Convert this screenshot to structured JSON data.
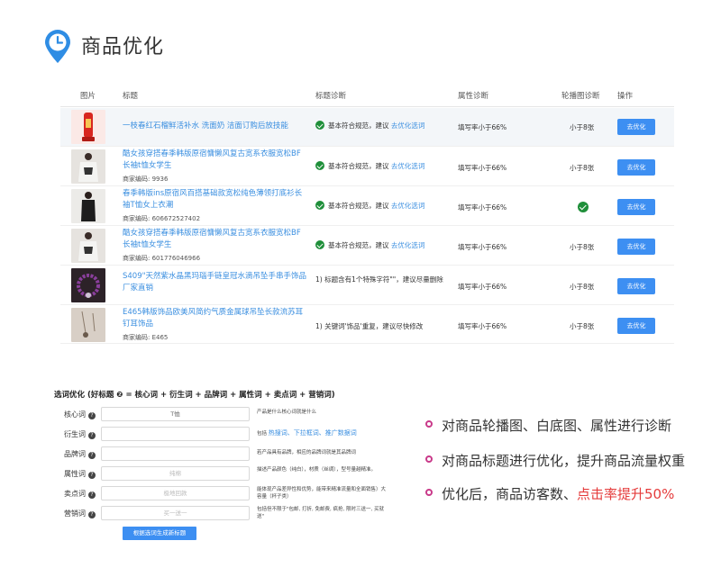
{
  "header": {
    "title": "商品优化",
    "icon": "clock-pin-icon",
    "accent": "#2f8de4"
  },
  "table": {
    "columns": [
      "图片",
      "标题",
      "标题诊断",
      "属性诊断",
      "轮播图诊断",
      "操作"
    ],
    "rows": [
      {
        "title": "一枝春红石榴鲜活补水 洗面奶 洁面订购后放技能",
        "code": "",
        "title_diag_prefix": "基本符合规范，建议",
        "title_diag_link": "去优化选词",
        "attr_diag": "填写率小于66%",
        "carousel_diag": "小于8张",
        "action": "去优化"
      },
      {
        "title": "酷女孩穿搭春季韩版原宿慵懒风复古宽系衣服宽松BF长袖t恤女学生",
        "code": "商家编码: 9936",
        "title_diag_prefix": "基本符合规范，建议",
        "title_diag_link": "去优化选词",
        "attr_diag": "填写率小于66%",
        "carousel_diag": "小于8张",
        "action": "去优化"
      },
      {
        "title": "春季韩版ins原宿风百搭基础款宽松纯色薄领打底衫长袖T恤女上衣潮",
        "code": "商家编码: 606672527402",
        "title_diag_prefix": "基本符合规范，建议",
        "title_diag_link": "去优化选词",
        "attr_diag": "填写率小于66%",
        "carousel_diag": "",
        "action": "去优化"
      },
      {
        "title": "酷女孩穿搭春季韩版原宿慵懒风复古宽系衣服宽松BF长袖t恤女学生",
        "code": "商家编码: 601776046966",
        "title_diag_prefix": "基本符合规范，建议",
        "title_diag_link": "去优化选词",
        "attr_diag": "填写率小于66%",
        "carousel_diag": "小于8张",
        "action": "去优化"
      },
      {
        "title": "S409\"天然紫水晶黑玛瑙手链皇冠水滴吊坠手串手饰品厂家直销",
        "code": "",
        "title_diag_text": "1) 标题含有1个特殊字符\"\"，建议尽量删除",
        "attr_diag": "填写率小于66%",
        "carousel_diag": "小于8张",
        "action": "去优化"
      },
      {
        "title": "E465韩版饰品欧美风简约气质金属球吊坠长款流苏耳钉耳饰品",
        "code": "商家编码: E465",
        "title_diag_text": "1) 关键词'饰品'重复，建议尽快修改",
        "attr_diag": "填写率小于66%",
        "carousel_diag": "小于8张",
        "action": "去优化"
      }
    ]
  },
  "form": {
    "title": "选词优化  (好标题 ❷ = 核心词 + 衍生词 + 品牌词 + 属性词 + 卖点词 + 营销词)",
    "fields": [
      {
        "label": "核心词",
        "value": "T恤",
        "desc": "产品是什么核心词就是什么"
      },
      {
        "label": "衍生词",
        "value": "",
        "desc_prefix": "包括",
        "desc_links": "热搜词、下拉框词、推广数据词"
      },
      {
        "label": "品牌词",
        "value": "",
        "desc": "若产品具有品牌，相应的品牌词就是其品牌词"
      },
      {
        "label": "属性词",
        "value": "",
        "placeholder": "纯棉",
        "desc": "描述产品颜色（纯白），材质（丝绸），型号量越精准。"
      },
      {
        "label": "卖点词",
        "value": "",
        "placeholder": "极地回款",
        "desc": "能体现产品差异性和优势，能带来精准流量和全面销售）大容量（杯子类）"
      },
      {
        "label": "营销词",
        "value": "",
        "placeholder": "买一送一",
        "desc": "包括但不限于\"包邮, 打折, 免邮费, 疯抢, 限时三送一, 买就送\""
      }
    ],
    "generate_button": "根据选词生成新标题"
  },
  "bullets": [
    {
      "text": "对商品轮播图、白底图、属性进行诊断"
    },
    {
      "text": "对商品标题进行优化，提升商品流量权重"
    },
    {
      "prefix": "优化后，商品访客数、",
      "highlight": "点击率提升50%"
    }
  ],
  "colors": {
    "link": "#3b8fe0",
    "button": "#3d8ff2",
    "check": "#1f8f3a",
    "bullet": "#c93a8a",
    "highlight": "#e53b3b"
  }
}
